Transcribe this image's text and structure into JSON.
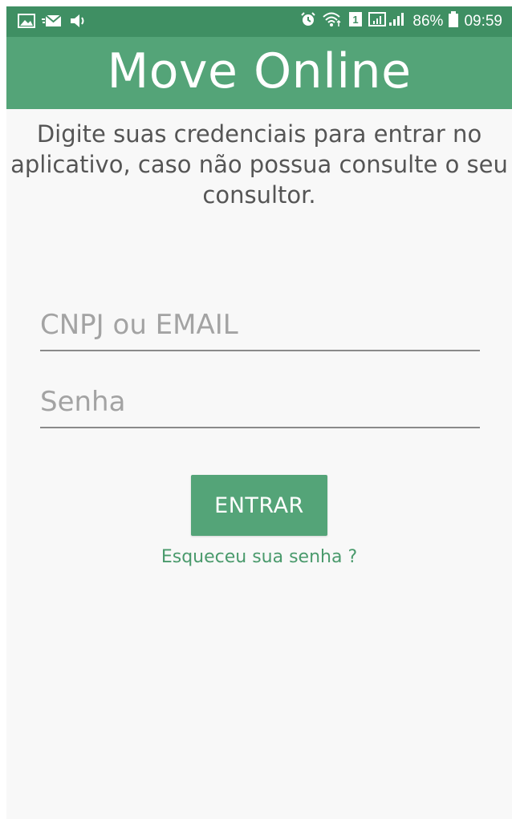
{
  "status_bar": {
    "battery": "86%",
    "time": "09:59",
    "left_icons": [
      "gallery-icon",
      "message-icon",
      "speaker-icon"
    ],
    "right_icons": [
      "alarm-icon",
      "wifi-icon",
      "sim-icon",
      "signal-icon"
    ]
  },
  "app_bar": {
    "title": "Move Online"
  },
  "login": {
    "intro": "Digite suas credenciais para entrar no aplicativo, caso não possua consulte o seu consultor.",
    "email_placeholder": "CNPJ ou EMAIL",
    "password_placeholder": "Senha",
    "submit_label": "ENTRAR",
    "forgot_label": "Esqueceu sua senha ?"
  },
  "colors": {
    "status_bar": "#3f8f63",
    "primary": "#54a478",
    "link": "#4a9a6c",
    "background": "#f8f8f8"
  }
}
